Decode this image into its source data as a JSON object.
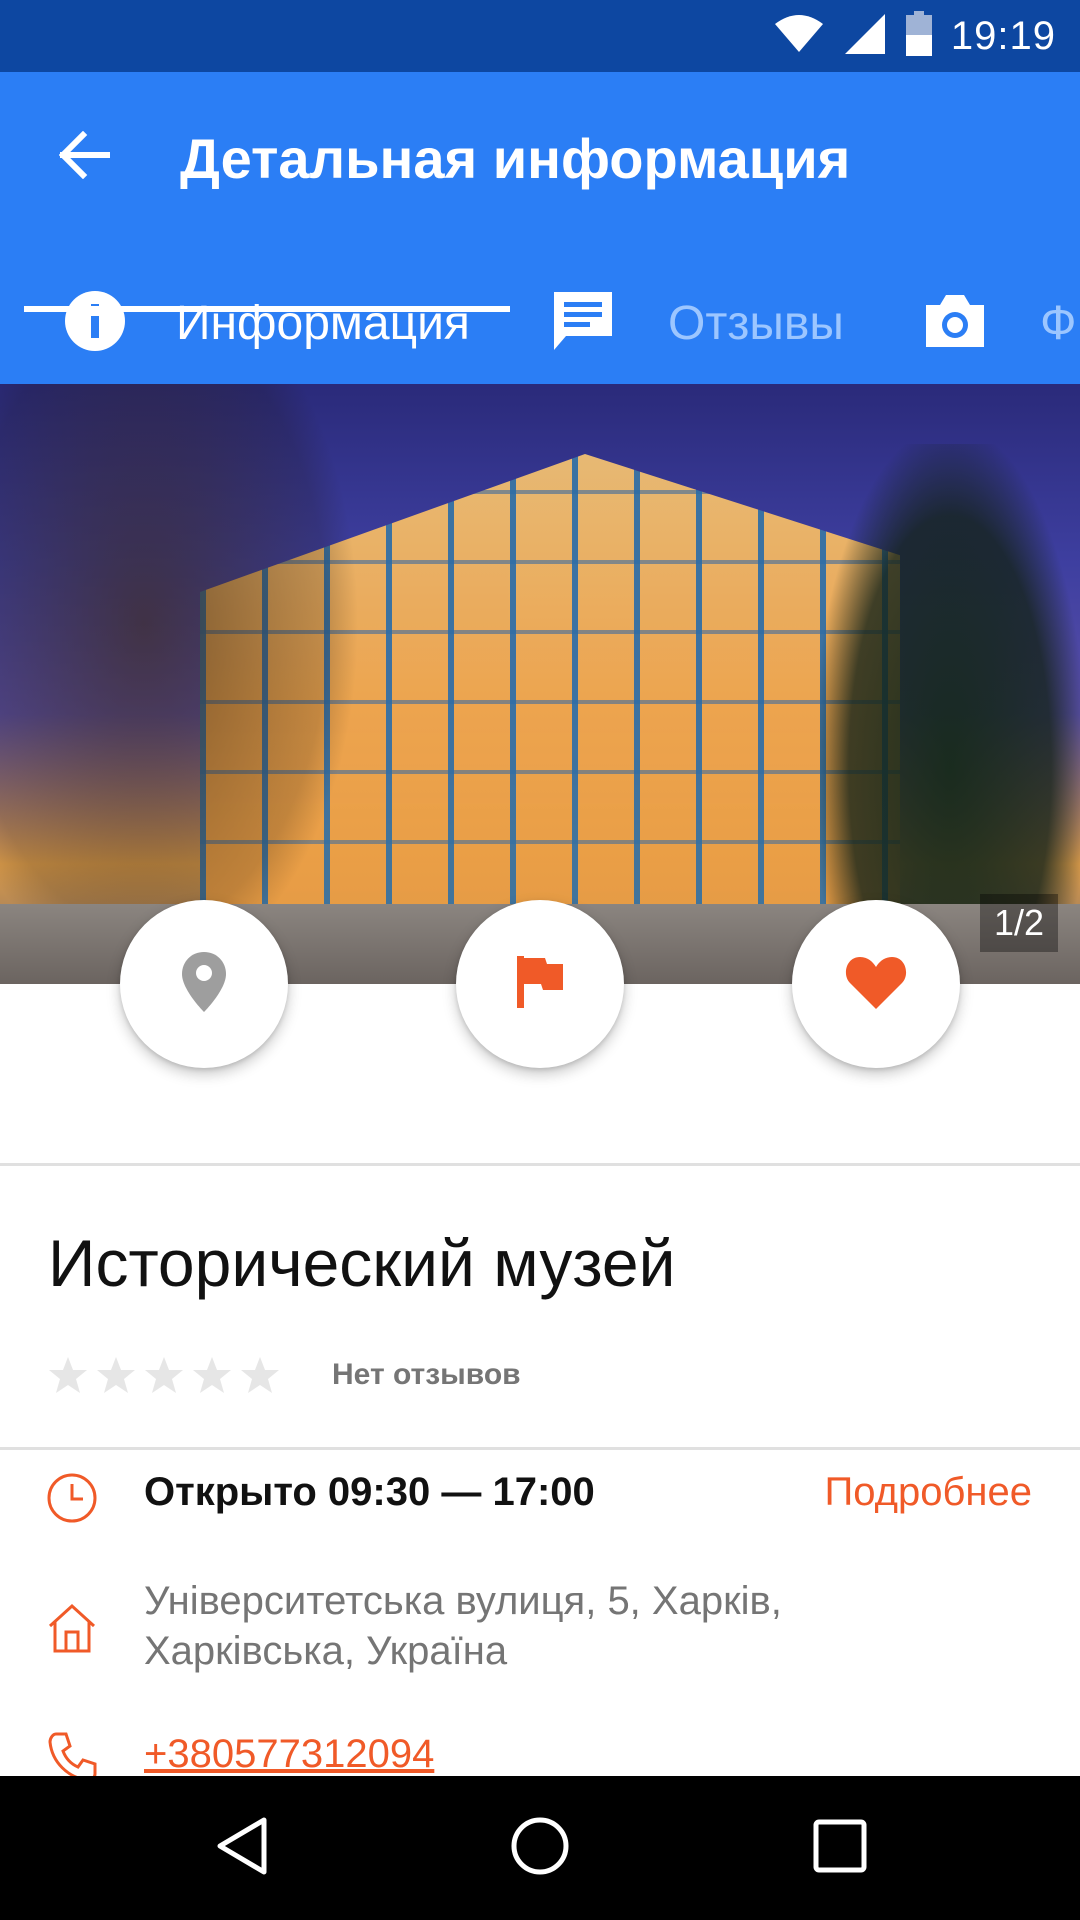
{
  "status_bar": {
    "time": "19:19",
    "icons": [
      "wifi-icon",
      "signal-icon",
      "battery-icon"
    ]
  },
  "app_bar": {
    "title": "Детальная информация",
    "back_icon": "arrow-back-icon",
    "background": "#2b7ef5"
  },
  "tabs": [
    {
      "label": "Информация",
      "icon": "info-icon",
      "active": true
    },
    {
      "label": "Отзывы",
      "icon": "chat-icon",
      "active": false
    },
    {
      "label": "Ф",
      "icon": "camera-icon",
      "active": false
    }
  ],
  "photo": {
    "counter": "1/2"
  },
  "actions": [
    {
      "name": "location",
      "icon": "map-pin-icon"
    },
    {
      "name": "flag",
      "icon": "flag-icon"
    },
    {
      "name": "favorite",
      "icon": "heart-icon"
    }
  ],
  "place": {
    "title": "Исторический музей",
    "rating_stars": 0,
    "rating_max": 5,
    "reviews_text": "Нет отзывов"
  },
  "details": {
    "hours": "Открыто 09:30 — 17:00",
    "more_label": "Подробнее",
    "address_line1": "Університетська вулиця, 5, Харків,",
    "address_line2": "Харківська, Україна",
    "phone": "+380577312094"
  },
  "colors": {
    "accent": "#f05a28",
    "primary": "#2b7ef5",
    "status_bar": "#0d47a1"
  }
}
